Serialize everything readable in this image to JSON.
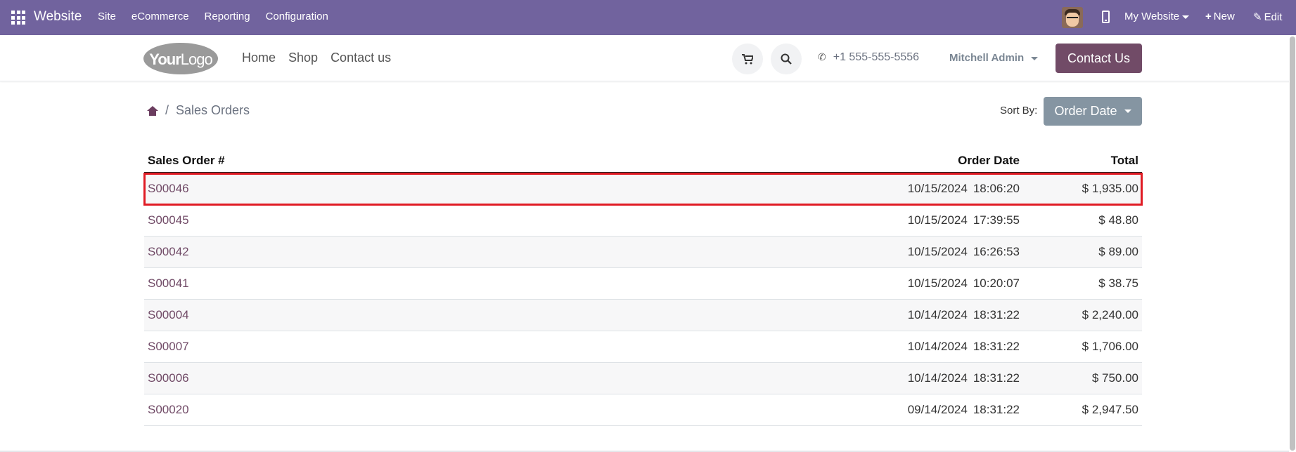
{
  "topbar": {
    "brand": "Website",
    "menu": [
      "Site",
      "eCommerce",
      "Reporting",
      "Configuration"
    ],
    "my_website": "My Website",
    "new_label": "New",
    "edit_label": "Edit"
  },
  "site": {
    "logo_bold": "Your",
    "logo_rest": "Logo",
    "nav": [
      "Home",
      "Shop",
      "Contact us"
    ],
    "phone": "+1 555-555-5556",
    "user": "Mitchell Admin",
    "contact_button": "Contact Us"
  },
  "breadcrumb": {
    "separator": "/",
    "current": "Sales Orders"
  },
  "sort": {
    "label": "Sort By:",
    "value": "Order Date"
  },
  "table": {
    "headers": [
      "Sales Order #",
      "Order Date",
      "Total"
    ],
    "rows": [
      {
        "number": "S00046",
        "date": "10/15/2024",
        "time": "18:06:20",
        "total": "$ 1,935.00"
      },
      {
        "number": "S00045",
        "date": "10/15/2024",
        "time": "17:39:55",
        "total": "$ 48.80"
      },
      {
        "number": "S00042",
        "date": "10/15/2024",
        "time": "16:26:53",
        "total": "$ 89.00"
      },
      {
        "number": "S00041",
        "date": "10/15/2024",
        "time": "10:20:07",
        "total": "$ 38.75"
      },
      {
        "number": "S00004",
        "date": "10/14/2024",
        "time": "18:31:22",
        "total": "$ 2,240.00"
      },
      {
        "number": "S00007",
        "date": "10/14/2024",
        "time": "18:31:22",
        "total": "$ 1,706.00"
      },
      {
        "number": "S00006",
        "date": "10/14/2024",
        "time": "18:31:22",
        "total": "$ 750.00"
      },
      {
        "number": "S00020",
        "date": "09/14/2024",
        "time": "18:31:22",
        "total": "$ 2,947.50"
      }
    ]
  },
  "colors": {
    "topbar": "#71639e",
    "accent": "#714b67",
    "highlight": "#e01b24",
    "sort_button": "#8595a2"
  }
}
